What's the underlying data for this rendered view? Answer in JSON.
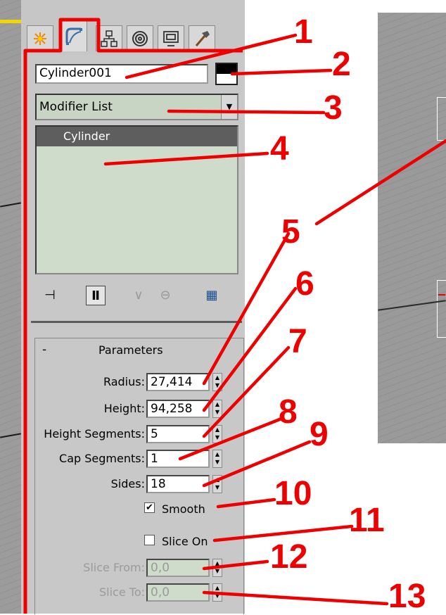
{
  "object_name": "Cylinder001",
  "modifier_list": "Modifier List",
  "stack_item": "Cylinder",
  "params": {
    "header": "Parameters",
    "collapse": "-",
    "radius_label": "Radius:",
    "radius": "27,414",
    "height_label": "Height:",
    "height": "94,258",
    "height_segments_label": "Height Segments:",
    "height_segments": "5",
    "cap_segments_label": "Cap Segments:",
    "cap_segments": "1",
    "sides_label": "Sides:",
    "sides": "18",
    "smooth_label": "Smooth",
    "smooth_checked": true,
    "slice_on_label": "Slice On",
    "slice_on_checked": false,
    "slice_from_label": "Slice From:",
    "slice_from": "0,0",
    "slice_to_label": "Slice To:",
    "slice_to": "0,0"
  },
  "callouts": [
    "1",
    "2",
    "3",
    "4",
    "5",
    "6",
    "7",
    "8",
    "9",
    "10",
    "11",
    "12",
    "13"
  ],
  "colors": {
    "panel": "#c8c8c8",
    "field_green": "#cfdccb",
    "highlight": "#ee0000",
    "stack_item_bg": "#5e5e5e"
  },
  "tabs": [
    "create-icon",
    "modify-icon",
    "hierarchy-icon",
    "motion-icon",
    "display-icon",
    "utilities-icon"
  ]
}
